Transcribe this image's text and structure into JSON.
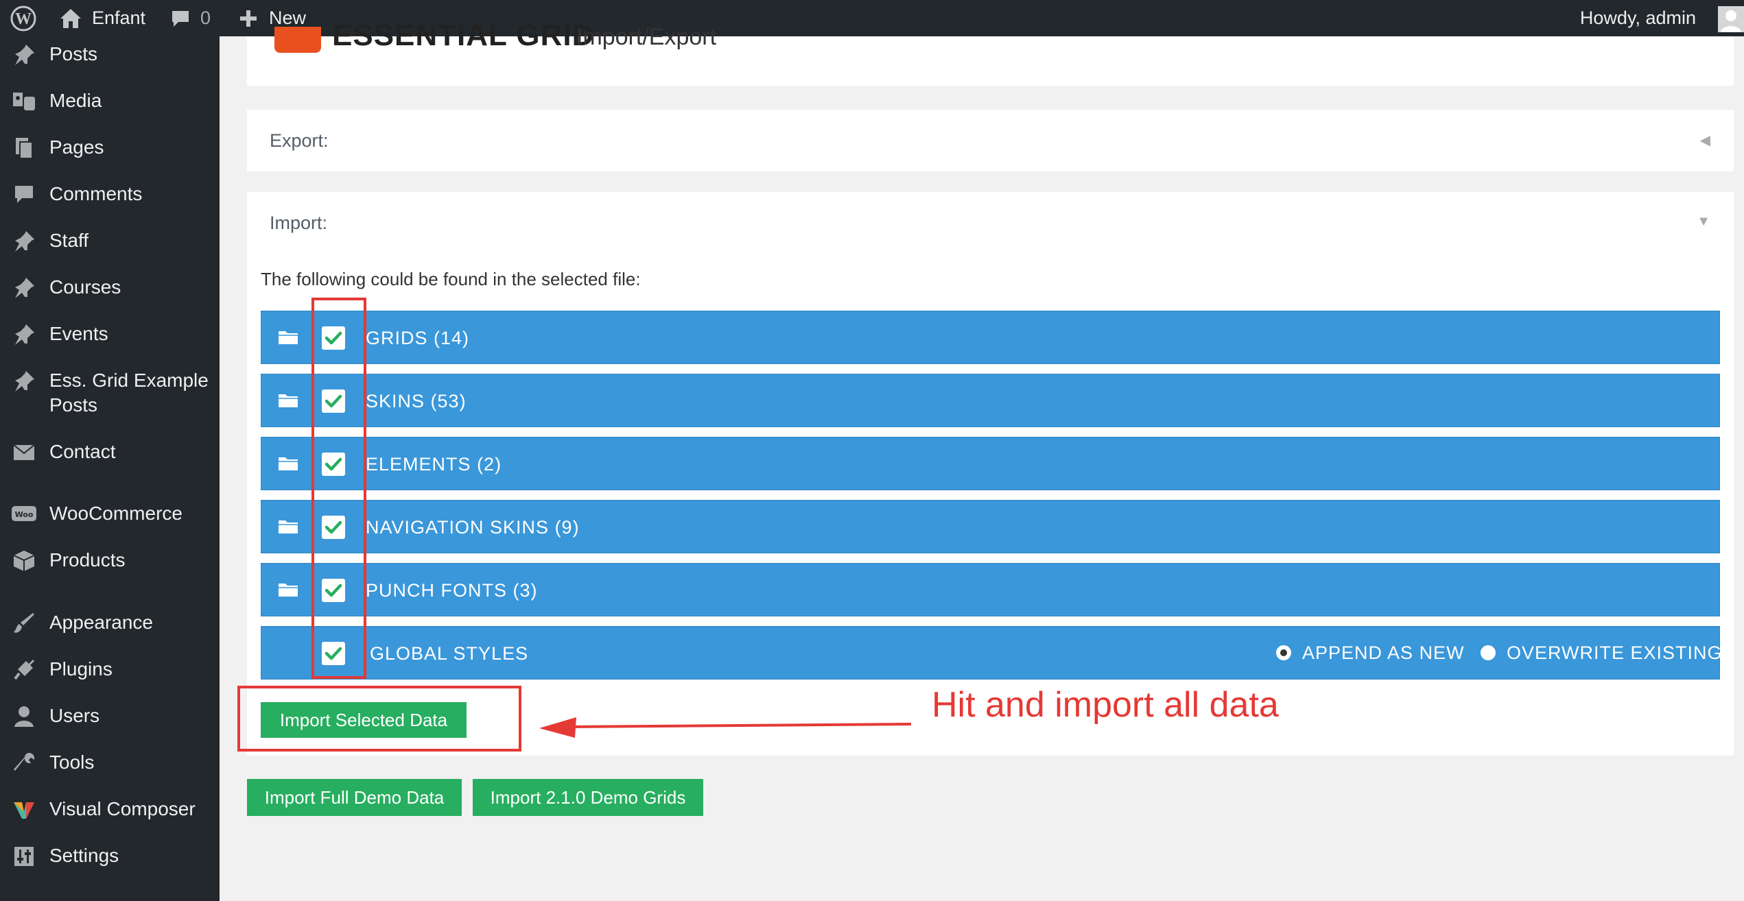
{
  "admin_bar": {
    "site_name": "Enfant",
    "comments_count": "0",
    "new_label": "New",
    "howdy": "Howdy, admin"
  },
  "sidebar": {
    "items": [
      {
        "label": "Posts",
        "icon": "pin-icon"
      },
      {
        "label": "Media",
        "icon": "media-icon"
      },
      {
        "label": "Pages",
        "icon": "pages-icon"
      },
      {
        "label": "Comments",
        "icon": "comment-icon"
      },
      {
        "label": "Staff",
        "icon": "pin-icon"
      },
      {
        "label": "Courses",
        "icon": "pin-icon"
      },
      {
        "label": "Events",
        "icon": "pin-icon"
      },
      {
        "label": "Ess. Grid Example Posts",
        "icon": "pin-icon"
      },
      {
        "label": "Contact",
        "icon": "mail-icon"
      },
      {
        "label": "WooCommerce",
        "icon": "woo-icon"
      },
      {
        "label": "Products",
        "icon": "box-icon"
      },
      {
        "label": "Appearance",
        "icon": "brush-icon"
      },
      {
        "label": "Plugins",
        "icon": "plug-icon"
      },
      {
        "label": "Users",
        "icon": "user-icon"
      },
      {
        "label": "Tools",
        "icon": "wrench-icon"
      },
      {
        "label": "Visual Composer",
        "icon": "vc-icon"
      },
      {
        "label": "Settings",
        "icon": "sliders-icon"
      }
    ]
  },
  "header": {
    "logo_text": "ESSENTIAL GRID",
    "page_title": "Import/Export"
  },
  "export_section": {
    "title": "Export:"
  },
  "import_section": {
    "title": "Import:",
    "intro": "The following could be found in the selected file:",
    "rows": [
      {
        "label": "GRIDS",
        "count": "(14)"
      },
      {
        "label": "SKINS",
        "count": "(53)"
      },
      {
        "label": "ELEMENTS",
        "count": "(2)"
      },
      {
        "label": "NAVIGATION SKINS",
        "count": "(9)"
      },
      {
        "label": "PUNCH FONTS",
        "count": "(3)"
      },
      {
        "label": "GLOBAL STYLES",
        "count": ""
      }
    ],
    "global_styles_options": {
      "append": "APPEND AS NEW",
      "overwrite": "OVERWRITE EXISTING",
      "selected": "append"
    },
    "import_selected_label": "Import Selected Data"
  },
  "bottom_buttons": {
    "full_demo": "Import Full Demo Data",
    "demo_grids": "Import 2.1.0 Demo Grids"
  },
  "annotation": {
    "text": "Hit and import all data",
    "color": "#e53935"
  },
  "colors": {
    "admin_bar": "#23282d",
    "row_blue": "#3a97da",
    "button_green": "#27ae60",
    "check_green": "#27ae60",
    "logo_orange": "#e8501f"
  }
}
